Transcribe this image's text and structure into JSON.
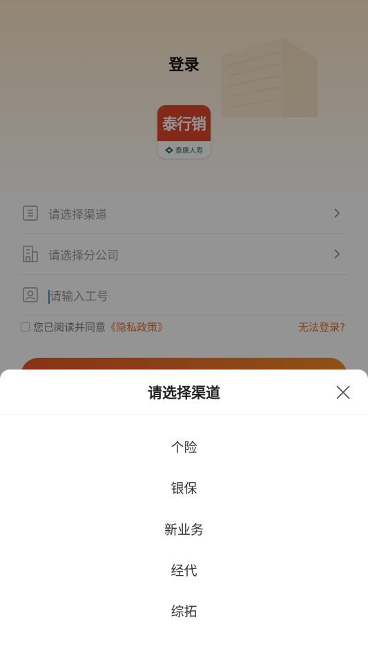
{
  "header": {
    "title": "登录"
  },
  "logo": {
    "main_text": "泰行销",
    "sub_text": "泰康人寿"
  },
  "form": {
    "channel_placeholder": "请选择渠道",
    "branch_placeholder": "请选择分公司",
    "employee_id_placeholder": "请输入工号"
  },
  "agreement": {
    "prefix": "您已阅读并同意",
    "policy_link": "《隐私政策》",
    "cannot_login": "无法登录?"
  },
  "sheet": {
    "title": "请选择渠道",
    "options": [
      "个险",
      "银保",
      "新业务",
      "经代",
      "综拓"
    ]
  },
  "colors": {
    "accent": "#e0722e",
    "logo_red": "#e0482b",
    "button_gradient_start": "#e65a28",
    "button_gradient_end": "#f28c2a"
  },
  "icons": [
    "list-icon",
    "building-icon",
    "person-icon",
    "chevron-right-icon",
    "close-icon"
  ]
}
